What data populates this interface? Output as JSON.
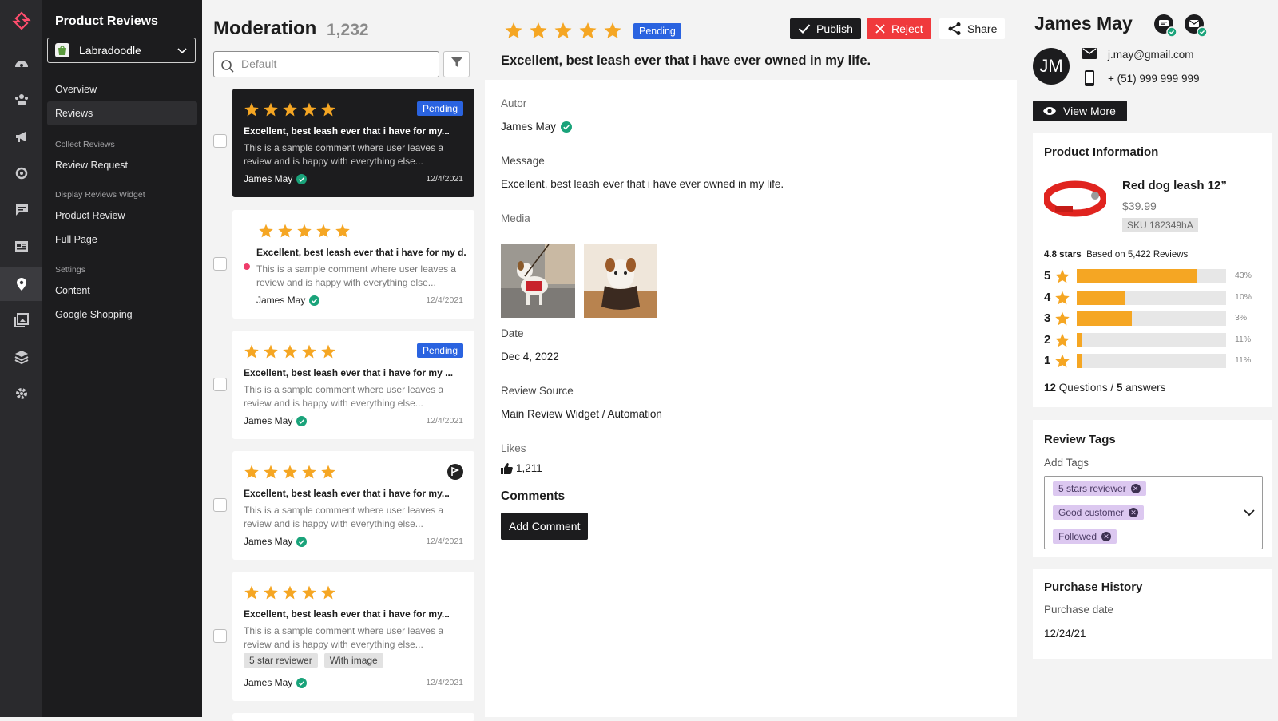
{
  "sidebar": {
    "title": "Product Reviews",
    "store": "Labradoodle",
    "items": [
      {
        "label": "Overview"
      },
      {
        "label": "Reviews"
      }
    ],
    "section_collect": "Collect Reviews",
    "collect_items": [
      {
        "label": "Review Request"
      }
    ],
    "section_display": "Display Reviews Widget",
    "display_items": [
      {
        "label": "Product Review"
      },
      {
        "label": "Full Page"
      }
    ],
    "section_settings": "Settings",
    "settings_items": [
      {
        "label": "Content"
      },
      {
        "label": "Google Shopping"
      }
    ]
  },
  "moderation": {
    "title": "Moderation",
    "count": "1,232",
    "search_placeholder": "Default",
    "cards": [
      {
        "title": "Excellent, best leash ever that i have for my...",
        "body": "This is a sample comment where user leaves a review and is happy with everything else...",
        "author": "James May",
        "date": "12/4/2021",
        "badge": "Pending"
      },
      {
        "title": "Excellent, best leash ever that i have for my d.",
        "body": "This is a sample comment where user leaves a review and is happy with everything else...",
        "author": "James May",
        "date": "12/4/2021"
      },
      {
        "title": "Excellent, best leash ever that i have for my ...",
        "body": "This is a sample comment where user leaves a review and is happy with everything else...",
        "author": "James May",
        "date": "12/4/2021",
        "badge": "Pending"
      },
      {
        "title": "Excellent, best leash ever that i have for my...",
        "body": "This is a sample comment where user leaves a review and is happy with everything else...",
        "author": "James May",
        "date": "12/4/2021"
      },
      {
        "title": "Excellent, best leash ever that i have for my...",
        "body": "This is a sample comment where user leaves a review and is happy with everything else...",
        "author": "James May",
        "date": "12/4/2021",
        "tags": [
          "5 star reviewer",
          "With image"
        ]
      }
    ]
  },
  "detail": {
    "status": "Pending",
    "publish": "Publish",
    "reject": "Reject",
    "share": "Share",
    "headline": "Excellent, best leash ever that i have ever owned in my life.",
    "autor_label": "Autor",
    "autor": "James May",
    "message_label": "Message",
    "message": "Excellent, best leash ever that i have ever owned in my life.",
    "media_label": "Media",
    "date_label": "Date",
    "date": "Dec 4, 2022",
    "source_label": "Review Source",
    "source": "Main Review Widget / Automation",
    "likes_label": "Likes",
    "likes": "1,211",
    "comments_label": "Comments",
    "add_comment": "Add Comment"
  },
  "customer": {
    "name": "James May",
    "initials": "JM",
    "email": "j.may@gmail.com",
    "phone": "+ (51) 999 999 999",
    "view_more": "View More"
  },
  "product": {
    "heading": "Product Information",
    "name": "Red dog leash 12”",
    "price": "$39.99",
    "sku": "SKU 182349hA",
    "rating": "4.8 stars",
    "based_on": "Based on 5,422 Reviews",
    "bars": [
      {
        "stars": "5",
        "pct": "43%",
        "fraction": 0.81
      },
      {
        "stars": "4",
        "pct": "10%",
        "fraction": 0.32
      },
      {
        "stars": "3",
        "pct": "3%",
        "fraction": 0.37
      },
      {
        "stars": "2",
        "pct": "11%",
        "fraction": 0.03
      },
      {
        "stars": "1",
        "pct": "11%",
        "fraction": 0.03
      }
    ],
    "questions_count": "12",
    "questions_label": "Questions",
    "answers_count": "5",
    "answers_label": "answers"
  },
  "tags": {
    "heading": "Review Tags",
    "add_label": "Add Tags",
    "items": [
      "5 stars reviewer",
      "Good customer",
      "Followed"
    ]
  },
  "purchase": {
    "heading": "Purchase History",
    "date_label": "Purchase date",
    "date": "12/24/21"
  },
  "colors": {
    "star": "#f5a623",
    "pending": "#2a63e0",
    "reject": "#f0393c",
    "verified": "#1aa37a"
  }
}
